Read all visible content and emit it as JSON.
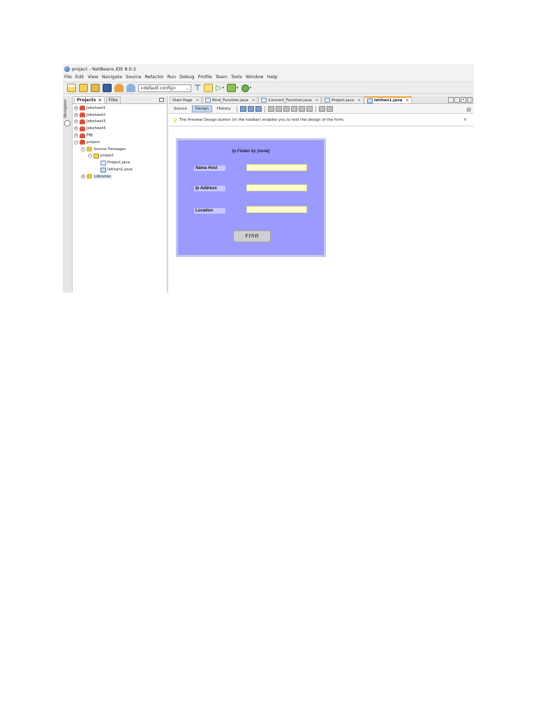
{
  "window": {
    "title": "project - NetBeans IDE 8.0.2"
  },
  "menu": [
    "File",
    "Edit",
    "View",
    "Navigate",
    "Source",
    "Refactor",
    "Run",
    "Debug",
    "Profile",
    "Team",
    "Tools",
    "Window",
    "Help"
  ],
  "toolbar": {
    "config_value": "<default config>"
  },
  "navigator": {
    "label": "Navigator"
  },
  "projects_panel": {
    "tabs": [
      "Projects",
      "Files"
    ],
    "tab_close": "×",
    "tree": [
      {
        "expander": "+",
        "label": "Jobsheet1"
      },
      {
        "expander": "+",
        "label": "Jobsheet2"
      },
      {
        "expander": "+",
        "label": "Jobsheet3"
      },
      {
        "expander": "+",
        "label": "Jobsheet4"
      },
      {
        "expander": "+",
        "label": "PBJ"
      },
      {
        "expander": "−",
        "label": "project"
      },
      {
        "expander": "−",
        "label": "Source Packages"
      },
      {
        "expander": "−",
        "label": "project"
      },
      {
        "expander": "",
        "label": "Project.java"
      },
      {
        "expander": "",
        "label": "latihan1.java"
      },
      {
        "expander": "+",
        "label": "Libraries"
      }
    ]
  },
  "editor": {
    "tabs": [
      "Start Page",
      "Bind_Function.java",
      "Connect_Function.java",
      "Project.java",
      "latihan1.java"
    ],
    "tab_close": "×",
    "views": [
      "Source",
      "Design",
      "History"
    ],
    "hint": "The Preview Design button (in the toolbar) enables you to test the design of the form.",
    "hint_close": "×"
  },
  "form": {
    "title": "Ip Finder by (sone)",
    "labels": [
      "Nama Host",
      "Ip Address",
      "Location"
    ],
    "button": "FIND",
    "background": "#9a9aff",
    "input_color": "#ffffc8"
  }
}
